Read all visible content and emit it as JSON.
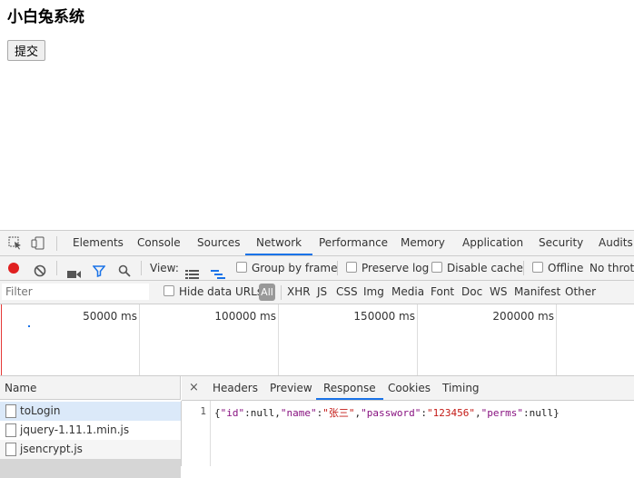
{
  "page": {
    "title": "小白兔系统",
    "submit_label": "提交"
  },
  "devtools": {
    "tabs": [
      "Elements",
      "Console",
      "Sources",
      "Network",
      "Performance",
      "Memory",
      "Application",
      "Security",
      "Audits"
    ],
    "active_tab": "Network",
    "toolbar": {
      "view_label": "View:",
      "group_by_frame": "Group by frame",
      "preserve_log": "Preserve log",
      "disable_cache": "Disable cache",
      "offline": "Offline",
      "throttling": "No thrott"
    },
    "filter": {
      "placeholder": "Filter",
      "hide_data_urls": "Hide data URLs",
      "all": "All",
      "types": [
        "XHR",
        "JS",
        "CSS",
        "Img",
        "Media",
        "Font",
        "Doc",
        "WS",
        "Manifest",
        "Other"
      ]
    },
    "timeline": {
      "ticks": [
        "50000 ms",
        "100000 ms",
        "150000 ms",
        "200000 ms"
      ]
    },
    "requests": {
      "header": "Name",
      "items": [
        "toLogin",
        "jquery-1.11.1.min.js",
        "jsencrypt.js"
      ]
    },
    "detail": {
      "close": "×",
      "tabs": [
        "Headers",
        "Preview",
        "Response",
        "Cookies",
        "Timing"
      ],
      "active_tab": "Response",
      "line_number": "1",
      "response_parts": {
        "p1": "{",
        "k1": "\"id\"",
        "c1": ":null,",
        "k2": "\"name\"",
        "c2": ":",
        "v2": "\"张三\"",
        "c3": ",",
        "k3": "\"password\"",
        "c4": ":",
        "v3": "\"123456\"",
        "c5": ",",
        "k4": "\"perms\"",
        "c6": ":null}"
      }
    }
  }
}
